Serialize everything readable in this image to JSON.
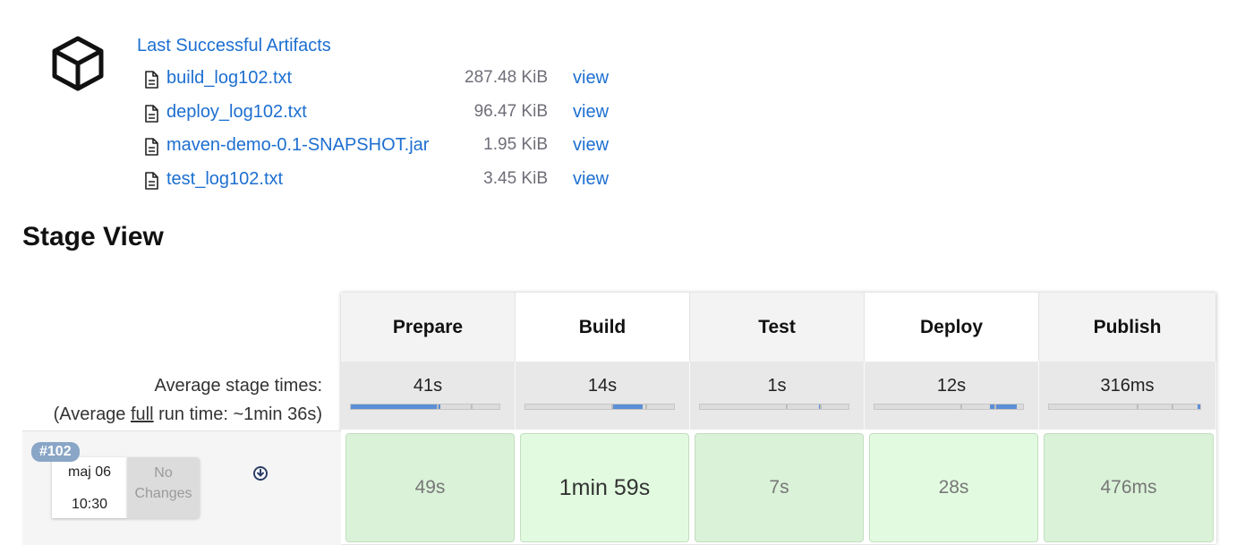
{
  "artifacts": {
    "title": "Last Successful Artifacts",
    "files": [
      {
        "name": "build_log102.txt",
        "size": "287.48 KiB",
        "view": "view"
      },
      {
        "name": "deploy_log102.txt",
        "size": "96.47 KiB",
        "view": "view"
      },
      {
        "name": "maven-demo-0.1-SNAPSHOT.jar",
        "size": "1.95 KiB",
        "view": "view"
      },
      {
        "name": "test_log102.txt",
        "size": "3.45 KiB",
        "view": "view"
      }
    ]
  },
  "stage_view": {
    "heading": "Stage View",
    "avg_label": "Average stage times:",
    "avg_full_prefix": "(Average ",
    "avg_full_word": "full",
    "avg_full_suffix": " run time: ~1min 36s)",
    "stages": [
      {
        "name": "Prepare",
        "avg": "41s",
        "avg_fraction": 0.6
      },
      {
        "name": "Build",
        "avg": "14s",
        "avg_fraction": 0.21
      },
      {
        "name": "Test",
        "avg": "1s",
        "avg_fraction": 0.02
      },
      {
        "name": "Deploy",
        "avg": "12s",
        "avg_fraction": 0.18
      },
      {
        "name": "Publish",
        "avg": "316ms",
        "avg_fraction": 0.005
      }
    ],
    "build": {
      "number": "#102",
      "date": "maj 06",
      "time": "10:30",
      "changes": "No Changes",
      "results": [
        "49s",
        "1min 59s",
        "7s",
        "28s",
        "476ms"
      ]
    }
  },
  "colors": {
    "link": "#1d6fd1",
    "bar_fill": "#5b8fd6",
    "success_cell": "#daf2d8",
    "badge": "#8aa6c6"
  }
}
